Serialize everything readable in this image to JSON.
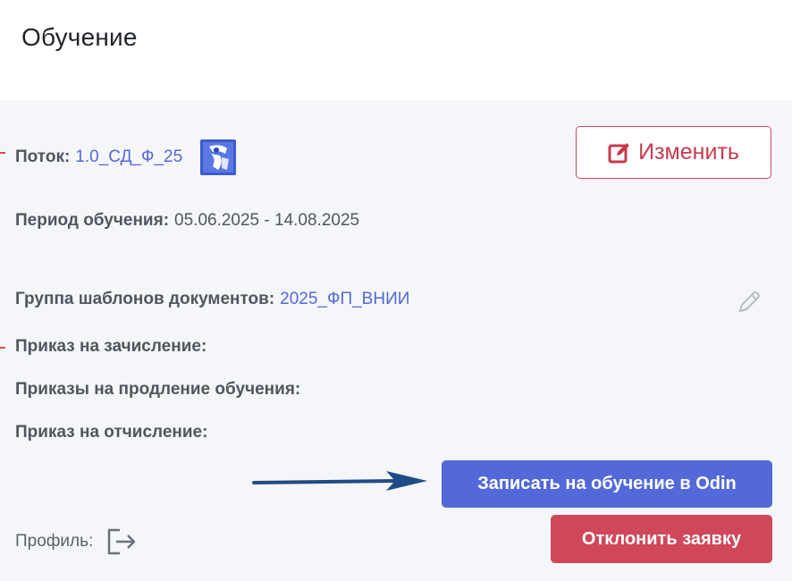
{
  "page": {
    "title": "Обучение"
  },
  "stream": {
    "label": "Поток:",
    "value": "1.0_СД_Ф_25"
  },
  "period": {
    "label": "Период обучения:",
    "value": "05.06.2025 - 14.08.2025"
  },
  "template_group": {
    "label": "Группа шаблонов документов:",
    "value": "2025_ФП_ВНИИ"
  },
  "orders": {
    "enrollment_label": "Приказ на зачисление:",
    "extension_label": "Приказы на продление обучения:",
    "expulsion_label": "Приказ на отчисление:"
  },
  "profile": {
    "label": "Профиль:"
  },
  "buttons": {
    "edit": "Изменить",
    "enroll": "Записать на обучение в Odin",
    "reject": "Отклонить заявку"
  },
  "colors": {
    "accent_blue": "#5369d9",
    "danger_red": "#cf4759",
    "link_blue": "#5468d6",
    "arrow_navy": "#1e4c86"
  },
  "icons": {
    "edit": "edit-square-icon",
    "pencil": "pencil-icon",
    "profile": "exit-icon",
    "logo": "emblem-icon",
    "arrow": "arrow-right-icon"
  }
}
